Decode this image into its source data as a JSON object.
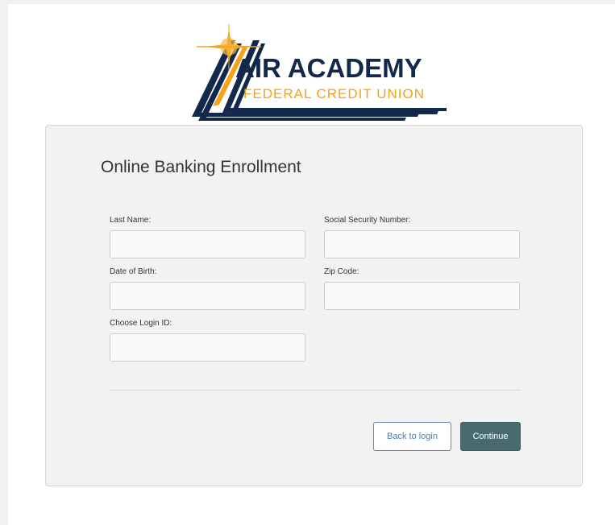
{
  "logo": {
    "line1": "AIR ACADEMY",
    "line2": "FEDERAL CREDIT UNION"
  },
  "enrollment": {
    "title": "Online Banking Enrollment",
    "fields": {
      "last_name": {
        "label": "Last Name:",
        "value": "",
        "placeholder": ""
      },
      "ssn": {
        "label": "Social Security Number:",
        "value": "",
        "placeholder": ""
      },
      "dob": {
        "label": "Date of Birth:",
        "value": "",
        "placeholder": ""
      },
      "zip": {
        "label": "Zip Code:",
        "value": "",
        "placeholder": ""
      },
      "login_id": {
        "label": "Choose Login ID:",
        "value": "",
        "placeholder": ""
      }
    },
    "buttons": {
      "back": "Back to login",
      "continue": "Continue"
    }
  },
  "colors": {
    "brand_navy": "#13294b",
    "brand_gold": "#f3a21b",
    "continue_bg": "#4a6b6e",
    "back_border": "#5d8ab8"
  }
}
